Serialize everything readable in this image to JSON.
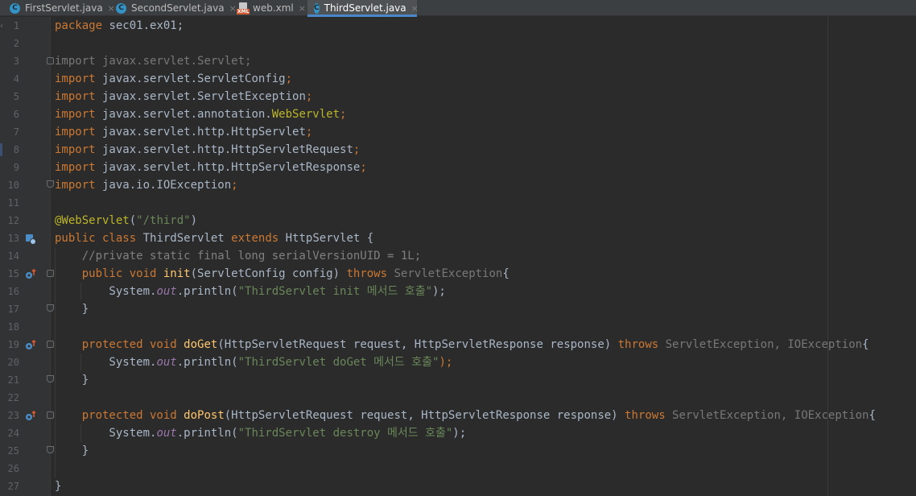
{
  "tabs": [
    {
      "label": "FirstServlet.java",
      "icon": "java-class-icon",
      "active": false
    },
    {
      "label": "SecondServlet.java",
      "icon": "java-class-icon",
      "active": false
    },
    {
      "label": "web.xml",
      "icon": "xml-file-icon",
      "active": false
    },
    {
      "label": "ThirdServlet.java",
      "icon": "java-class-icon",
      "active": true
    }
  ],
  "tab_close_glyph": "×",
  "icon_glyphs": {
    "java_class": "C",
    "xml": "XML"
  },
  "line_numbers": [
    "1",
    "2",
    "3",
    "4",
    "5",
    "6",
    "7",
    "8",
    "9",
    "10",
    "11",
    "12",
    "13",
    "14",
    "15",
    "16",
    "17",
    "18",
    "19",
    "20",
    "21",
    "22",
    "23",
    "24",
    "25",
    "26",
    "27"
  ],
  "code": {
    "l1": {
      "kw": "package",
      "rest": " sec01.ex01;"
    },
    "l3": {
      "kw": "import",
      "rest": " javax.servlet.Servlet;"
    },
    "l4": {
      "kw": "import",
      "rest": " javax.servlet.ServletConfig",
      "semi": ";"
    },
    "l5": {
      "kw": "import",
      "rest": " javax.servlet.ServletException",
      "semi": ";"
    },
    "l6": {
      "kw": "import",
      "rest": " javax.servlet.annotation.",
      "ann": "WebServlet",
      "semi": ";"
    },
    "l7": {
      "kw": "import",
      "rest": " javax.servlet.http.HttpServlet",
      "semi": ";"
    },
    "l8": {
      "kw": "import",
      "rest": " javax.servlet.http.HttpServletRequest",
      "semi": ";"
    },
    "l9": {
      "kw": "import",
      "rest": " javax.servlet.http.HttpServletResponse",
      "semi": ";"
    },
    "l10": {
      "kw": "import",
      "rest": " java.io.IOException",
      "semi": ";"
    },
    "l12": {
      "ann": "@WebServlet",
      "p1": "(",
      "str": "\"/third\"",
      "p2": ")"
    },
    "l13": {
      "kw1": "public class",
      "name": " ThirdServlet ",
      "kw2": "extends",
      "rest": " HttpServlet {"
    },
    "l14": {
      "comment": "    //private static final long serialVersionUID = 1L;"
    },
    "l15": {
      "indent": "    ",
      "kw": "public void",
      "fn": "init",
      "args": "(ServletConfig config) ",
      "kw2": "throws",
      "exc": " ServletException",
      "brace": "{"
    },
    "l16": {
      "pre": "        System.",
      "field": "out",
      "mid": ".println(",
      "str": "\"ThirdServlet init 메서드 호출\"",
      "end": ");"
    },
    "l17": {
      "text": "    }"
    },
    "l19": {
      "indent": "    ",
      "kw": "protected void",
      "fn": "doGet",
      "args": "(HttpServletRequest request, HttpServletResponse response) ",
      "kw2": "throws",
      "exc": " ServletException, IOException",
      "brace": "{"
    },
    "l20": {
      "pre": "        System.",
      "field": "out",
      "mid": ".println(",
      "str": "\"ThirdServlet doGet 메서드 호출\"",
      "end": ");"
    },
    "l21": {
      "text": "    }"
    },
    "l23": {
      "indent": "    ",
      "kw": "protected void",
      "fn": "doPost",
      "args": "(HttpServletRequest request, HttpServletResponse response) ",
      "kw2": "throws",
      "exc": " ServletException, IOException",
      "brace": "{"
    },
    "l24": {
      "pre": "        System.",
      "field": "out",
      "mid": ".println(",
      "str": "\"ThirdServlet destroy 메서드 호출\"",
      "end": ");"
    },
    "l25": {
      "text": "    }"
    },
    "l27": {
      "text": "}"
    }
  },
  "gutter_icons": {
    "l13": "run-servlet-icon",
    "l15": "override-method-icon",
    "l19": "override-method-icon",
    "l23": "override-method-icon"
  },
  "colors": {
    "keyword": "#cc7832",
    "string": "#6a8759",
    "comment": "#808080",
    "annotation": "#bbb529",
    "method": "#ffc66d",
    "field": "#9876aa",
    "tab_accent": "#4a88c7"
  }
}
